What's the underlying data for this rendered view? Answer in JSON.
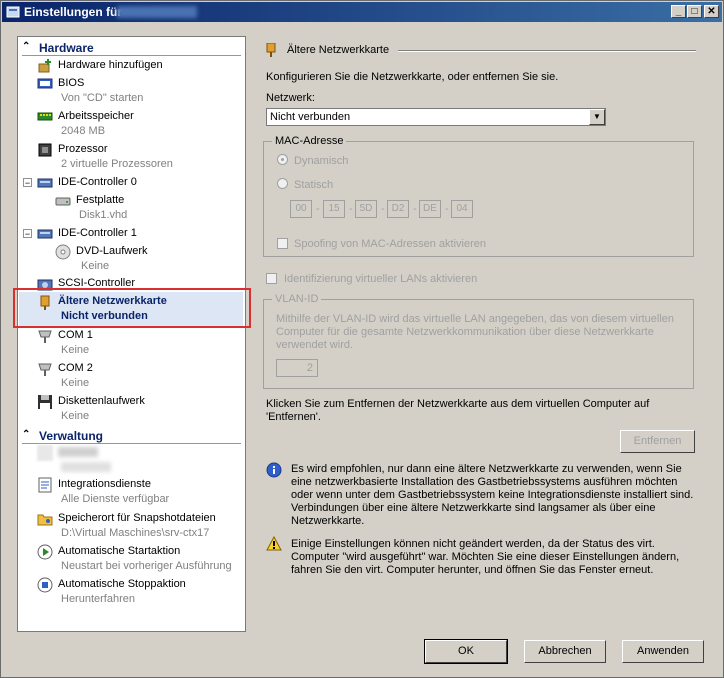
{
  "window": {
    "title": "Einstellungen für"
  },
  "sidebar": {
    "hardware": {
      "title": "Hardware",
      "items": [
        {
          "label": "Hardware hinzufügen",
          "sub": ""
        },
        {
          "label": "BIOS",
          "sub": "Von \"CD\" starten"
        },
        {
          "label": "Arbeitsspeicher",
          "sub": "2048 MB"
        },
        {
          "label": "Prozessor",
          "sub": "2 virtuelle Prozessoren"
        },
        {
          "label": "IDE-Controller 0",
          "sub": ""
        },
        {
          "label": "Festplatte",
          "sub": "Disk1.vhd"
        },
        {
          "label": "IDE-Controller 1",
          "sub": ""
        },
        {
          "label": "DVD-Laufwerk",
          "sub": "Keine"
        },
        {
          "label": "SCSI-Controller",
          "sub": ""
        },
        {
          "label": "Ältere Netzwerkkarte",
          "sub": "Nicht verbunden"
        },
        {
          "label": "COM 1",
          "sub": "Keine"
        },
        {
          "label": "COM 2",
          "sub": "Keine"
        },
        {
          "label": "Diskettenlaufwerk",
          "sub": "Keine"
        }
      ]
    },
    "management": {
      "title": "Verwaltung",
      "items": [
        {
          "label": "",
          "sub": ""
        },
        {
          "label": "Integrationsdienste",
          "sub": "Alle Dienste verfügbar"
        },
        {
          "label": "Speicherort für Snapshotdateien",
          "sub": "D:\\Virtual Maschines\\srv-ctx17"
        },
        {
          "label": "Automatische Startaktion",
          "sub": "Neustart bei vorheriger Ausführung"
        },
        {
          "label": "Automatische Stoppaktion",
          "sub": "Herunterfahren"
        }
      ]
    }
  },
  "main": {
    "header": "Ältere Netzwerkkarte",
    "intro": "Konfigurieren Sie die Netzwerkkarte, oder entfernen Sie sie.",
    "network_label": "Netzwerk:",
    "network_value": "Nicht verbunden",
    "mac": {
      "title": "MAC-Adresse",
      "dynamic": "Dynamisch",
      "static": "Statisch",
      "octets": [
        "00",
        "15",
        "5D",
        "D2",
        "DE",
        "04"
      ],
      "spoofing": "Spoofing von MAC-Adressen aktivieren"
    },
    "vlan_checkbox": "Identifizierung virtueller LANs aktivieren",
    "vlan": {
      "title": "VLAN-ID",
      "text1": "Mithilfe der VLAN-ID wird das virtuelle LAN angegeben, das von diesem virtuellen",
      "text2": "Computer für die gesamte Netzwerkkommunikation über diese Netzwerkkarte",
      "text3": "verwendet wird.",
      "value": "2"
    },
    "remove_text1": "Klicken Sie zum Entfernen der Netzwerkkarte aus dem virtuellen Computer auf",
    "remove_text2": "'Entfernen'.",
    "remove_button": "Entfernen",
    "info_text": "Es wird empfohlen, nur dann eine ältere Netzwerkkarte zu verwenden, wenn Sie eine netzwerkbasierte Installation des Gastbetriebssystems ausführen möchten oder wenn unter dem Gastbetriebssystem keine Integrationsdienste installiert sind. Verbindungen über eine ältere Netzwerkkarte sind langsamer als über eine Netzwerkkarte.",
    "warning_text": "Einige Einstellungen können nicht geändert werden, da der Status des virt. Computer \"wird ausgeführt\" war. Möchten Sie eine dieser Einstellungen ändern, fahren Sie den virt. Computer herunter, und öffnen Sie das Fenster erneut."
  },
  "footer": {
    "ok": "OK",
    "cancel": "Abbrechen",
    "apply": "Anwenden"
  }
}
